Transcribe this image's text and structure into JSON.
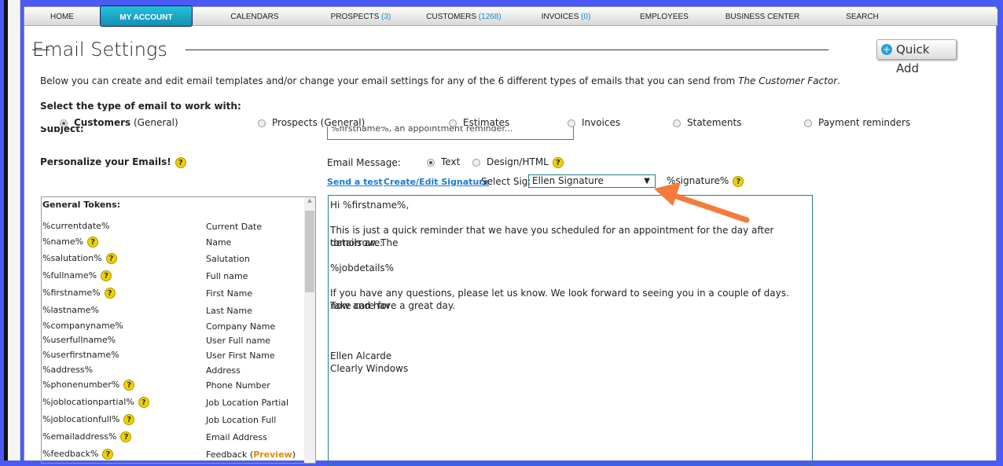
{
  "nav": [
    {
      "label": "HOME"
    },
    {
      "label": "MY ACCOUNT",
      "active": true
    },
    {
      "label": "CALENDARS"
    },
    {
      "label": "PROSPECTS",
      "count": "(3)"
    },
    {
      "label": "CUSTOMERS",
      "count": "(1268)"
    },
    {
      "label": "INVOICES",
      "count": "(0)"
    },
    {
      "label": "EMPLOYEES"
    },
    {
      "label": "BUSINESS CENTER"
    },
    {
      "label": "SEARCH"
    }
  ],
  "page_title": "Email Settings",
  "quick_add": "Quick Add",
  "intro": "Below you can create and edit email templates and/or change your email settings for any of the 6 different types of emails that you can send from ",
  "intro_brand": "The Customer Factor",
  "intro_end": ".",
  "select_type_label": "Select the type of email to work with:",
  "email_types": [
    {
      "label": "Customers",
      "suffix": " (General)",
      "checked": true
    },
    {
      "label": "Prospects (General)"
    },
    {
      "label": "Estimates"
    },
    {
      "label": "Invoices"
    },
    {
      "label": "Statements"
    },
    {
      "label": "Payment reminders"
    }
  ],
  "subject_label": "Subject:",
  "subject_value": "%firstname%, an appointment reminder...",
  "personalize_label": "Personalize your Emails!",
  "email_message_label": "Email Message:",
  "format_options": [
    {
      "label": "Text",
      "checked": true
    },
    {
      "label": "Design/HTML"
    }
  ],
  "send_test": "Send a test",
  "create_sig": "Create/Edit Signature",
  "select_sig_label": "Select Sig:",
  "select_sig_value": "Ellen Signature",
  "signature_token": "%signature%",
  "tokens_header": "General Tokens:",
  "tokens": [
    {
      "token": "%currentdate%",
      "desc": "Current Date"
    },
    {
      "token": "%name%",
      "desc": "Name",
      "help": true
    },
    {
      "token": "%salutation%",
      "desc": "Salutation",
      "help": true
    },
    {
      "token": "%fullname%",
      "desc": "Full name",
      "help": true
    },
    {
      "token": "%firstname%",
      "desc": "First Name",
      "help": true
    },
    {
      "token": "%lastname%",
      "desc": "Last Name"
    },
    {
      "token": "%companyname%",
      "desc": "Company Name"
    },
    {
      "token": "%userfullname%",
      "desc": "User Full name"
    },
    {
      "token": "%userfirstname%",
      "desc": "User First Name"
    },
    {
      "token": "%address%",
      "desc": "Address"
    },
    {
      "token": "%phonenumber%",
      "desc": "Phone Number",
      "help": true
    },
    {
      "token": "%joblocationpartial%",
      "desc": "Job Location Partial",
      "help": true
    },
    {
      "token": "%joblocationfull%",
      "desc": "Job Location Full",
      "help": true
    },
    {
      "token": "%emailaddress%",
      "desc": "Email Address",
      "help": true
    },
    {
      "token": "%feedback%",
      "desc": "Feedback",
      "help": true,
      "link": "Preview"
    }
  ],
  "message_lines": [
    "Hi %firstname%,",
    "",
    "This is just a quick reminder that we have you scheduled for an appointment for the day after tomorrow. The",
    "details are:",
    "",
    "%jobdetails%",
    "",
    "If you have any questions, please let us know. We look forward to seeing you in a couple of days. Take care for",
    "now and have a great day.",
    "",
    "",
    "",
    "Ellen Alcarde",
    "Clearly Windows"
  ],
  "colors": {
    "frame": "#4a5af2",
    "accent": "#1a9cc0",
    "annotation_arrow": "#f47b3c"
  }
}
